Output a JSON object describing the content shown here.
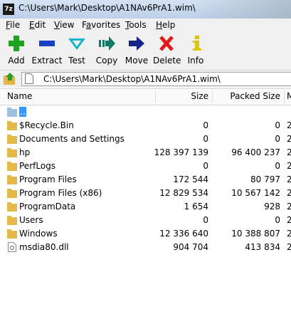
{
  "window": {
    "app_icon_text": "7z",
    "title": "C:\\Users\\Mark\\Desktop\\A1NAv6PrA1.wim\\"
  },
  "menu": [
    {
      "label": "File",
      "key": "F",
      "rest": "ile"
    },
    {
      "label": "Edit",
      "key": "E",
      "rest": "dit"
    },
    {
      "label": "View",
      "key": "V",
      "rest": "iew"
    },
    {
      "label": "Favorites",
      "key": "a",
      "pre": "F",
      "rest": "vorites"
    },
    {
      "label": "Tools",
      "key": "T",
      "rest": "ools"
    },
    {
      "label": "Help",
      "key": "H",
      "rest": "elp"
    }
  ],
  "toolbar": {
    "add": "Add",
    "extract": "Extract",
    "test": "Test",
    "copy": "Copy",
    "move": "Move",
    "delete": "Delete",
    "info": "Info"
  },
  "colors": {
    "add": "#1fa31f",
    "extract": "#1a3fc4",
    "test": "#18b4c9",
    "copy": "#137a6a",
    "move": "#13238a",
    "delete": "#e01919",
    "info": "#e0c400"
  },
  "address": {
    "path": "C:\\Users\\Mark\\Desktop\\A1NAv6PrA1.wim\\"
  },
  "columns": {
    "name": "Name",
    "size": "Size",
    "packed": "Packed Size",
    "modified": "M"
  },
  "files": [
    {
      "name": "..",
      "size": "",
      "packed": "",
      "mod": "",
      "icon": "folder-up-icon",
      "selected": true
    },
    {
      "name": "$Recycle.Bin",
      "size": "0",
      "packed": "0",
      "mod": "2",
      "icon": "folder-icon"
    },
    {
      "name": "Documents and Settings",
      "size": "0",
      "packed": "0",
      "mod": "2",
      "icon": "folder-icon"
    },
    {
      "name": "hp",
      "size": "128 397 139",
      "packed": "96 400 237",
      "mod": "2",
      "icon": "folder-icon"
    },
    {
      "name": "PerfLogs",
      "size": "0",
      "packed": "0",
      "mod": "2",
      "icon": "folder-icon"
    },
    {
      "name": "Program Files",
      "size": "172 544",
      "packed": "80 797",
      "mod": "2",
      "icon": "folder-icon"
    },
    {
      "name": "Program Files (x86)",
      "size": "12 829 534",
      "packed": "10 567 142",
      "mod": "2",
      "icon": "folder-icon"
    },
    {
      "name": "ProgramData",
      "size": "1 654",
      "packed": "928",
      "mod": "2",
      "icon": "folder-icon"
    },
    {
      "name": "Users",
      "size": "0",
      "packed": "0",
      "mod": "2",
      "icon": "folder-icon"
    },
    {
      "name": "Windows",
      "size": "12 336 640",
      "packed": "10 388 807",
      "mod": "2",
      "icon": "folder-icon"
    },
    {
      "name": "msdia80.dll",
      "size": "904 704",
      "packed": "413 834",
      "mod": "2",
      "icon": "dll-file-icon"
    }
  ]
}
